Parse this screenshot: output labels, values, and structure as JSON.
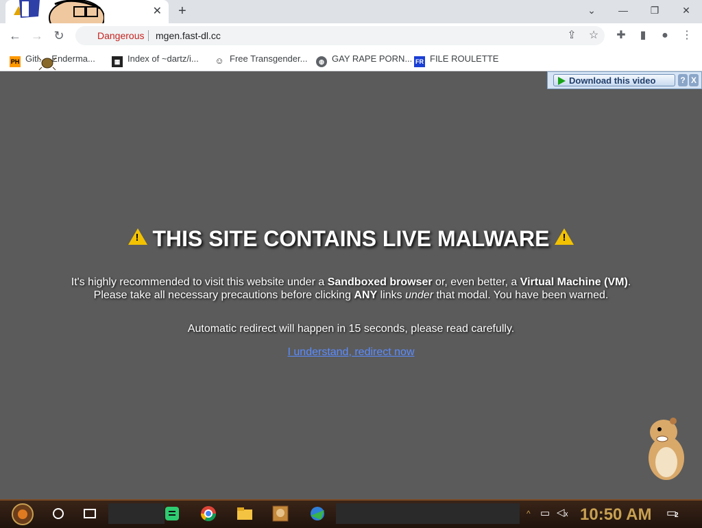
{
  "browser": {
    "tab": {
      "close_glyph": "✕"
    },
    "new_tab_glyph": "+",
    "window_controls": {
      "minimize": "—",
      "maximize": "❐",
      "close": "✕",
      "dropdown": "⌄"
    },
    "omnibox": {
      "security_label": "Dangerous",
      "url": "mgen.fast-dl.cc"
    },
    "icons": [
      "back-icon",
      "forward-icon",
      "reload-icon",
      "share-icon",
      "star-icon",
      "extensions-icon",
      "side-panel-icon",
      "profile-icon",
      "menu-icon"
    ]
  },
  "bookmarks": [
    {
      "label": "Gitl...- Enderma...",
      "icon": "ph-favicon"
    },
    {
      "label": "Index of ~dartz/i...",
      "icon": "index-favicon"
    },
    {
      "label": "Free Transgender...",
      "icon": "cat-favicon"
    },
    {
      "label": "GAY RAPE PORN...",
      "icon": "globe-favicon"
    },
    {
      "label": "FILE ROULETTE",
      "icon": "file-roulette-favicon"
    }
  ],
  "page": {
    "download_bar": {
      "label": "Download this video",
      "help": "?",
      "close": "X"
    },
    "headline": "THIS SITE CONTAINS LIVE MALWARE",
    "warning": {
      "line1_pre": "It's highly recommended to visit this website under a ",
      "line1_b1": "Sandboxed browser",
      "line1_mid": " or, even better, a ",
      "line1_b2": "Virtual Machine (VM)",
      "line1_end": ".",
      "line2_pre": "Please take all necessary precautions before clicking ",
      "line2_b": "ANY",
      "line2_mid": " links ",
      "line2_i": "under",
      "line2_end": " that modal. You have been warned."
    },
    "redirect_notice": "Automatic redirect will happen in 15 seconds, please read carefully.",
    "redirect_link": "I understand, redirect now"
  },
  "taskbar": {
    "clock": "10:50 AM",
    "notification_count": "2",
    "pinned_apps": [
      "start-orb-icon",
      "cortana-icon",
      "task-view-icon",
      "notes-app-icon",
      "chrome-icon",
      "file-explorer-icon",
      "game-app-icon",
      "network-app-icon"
    ]
  },
  "colors": {
    "page_bg": "#5b5b5b",
    "dangerous_text": "#c5221f",
    "link": "#5b8cff",
    "warning_yellow": "#f2c200",
    "clock": "#c8a052"
  }
}
